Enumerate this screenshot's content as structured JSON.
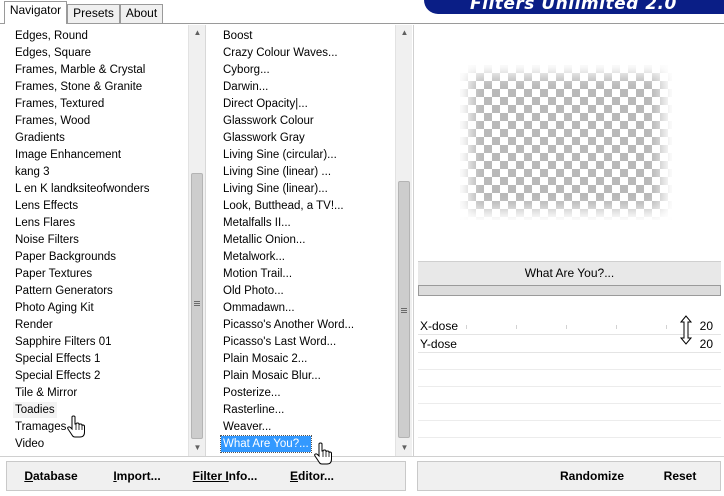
{
  "tabs": [
    {
      "label": "Navigator",
      "active": true
    },
    {
      "label": "Presets",
      "active": false
    },
    {
      "label": "About",
      "active": false
    }
  ],
  "brand": "Filters Unlimited 2.0",
  "categories": {
    "selected": "Toadies",
    "items": [
      "Edges, Round",
      "Edges, Square",
      "Frames, Marble & Crystal",
      "Frames, Stone & Granite",
      "Frames, Textured",
      "Frames, Wood",
      "Gradients",
      "Image Enhancement",
      "kang 3",
      "L en K landksiteofwonders",
      "Lens Effects",
      "Lens Flares",
      "Noise Filters",
      "Paper Backgrounds",
      "Paper Textures",
      "Pattern Generators",
      "Photo Aging Kit",
      "Render",
      "Sapphire Filters 01",
      "Special Effects 1",
      "Special Effects 2",
      "Tile & Mirror",
      "Toadies",
      "Tramages",
      "Video"
    ]
  },
  "filters": {
    "selected": "What Are You?...",
    "items": [
      "Boost",
      "Crazy Colour Waves...",
      "Cyborg...",
      "Darwin...",
      "Direct Opacity|...",
      "Glasswork Colour",
      "Glasswork Gray",
      "Living Sine (circular)...",
      "Living Sine (linear) ...",
      "Living Sine (linear)...",
      "Look, Butthead, a TV!...",
      "Metalfalls II...",
      "Metallic Onion...",
      "Metalwork...",
      "Motion Trail...",
      "Old Photo...",
      "Ommadawn...",
      "Picasso's Another Word...",
      "Picasso's Last Word...",
      "Plain Mosaic 2...",
      "Plain Mosaic Blur...",
      "Posterize...",
      "Rasterline...",
      "Weaver...",
      "What Are You?..."
    ]
  },
  "filter_title": "What Are You?...",
  "controls": [
    {
      "label": "X-dose",
      "value": "20"
    },
    {
      "label": "Y-dose",
      "value": "20"
    }
  ],
  "buttons": {
    "database": {
      "mnemonic": "D",
      "rest": "atabase"
    },
    "import": {
      "mnemonic": "I",
      "rest": "mport..."
    },
    "filter_info": {
      "mnemonic": "Filter I",
      "rest": "nfo..."
    },
    "editor": {
      "mnemonic": "E",
      "rest": "ditor..."
    },
    "randomize": "Randomize",
    "reset": "Reset"
  },
  "colors": {
    "selection": "#3399ff",
    "brand_bg": "#0a1e86"
  }
}
